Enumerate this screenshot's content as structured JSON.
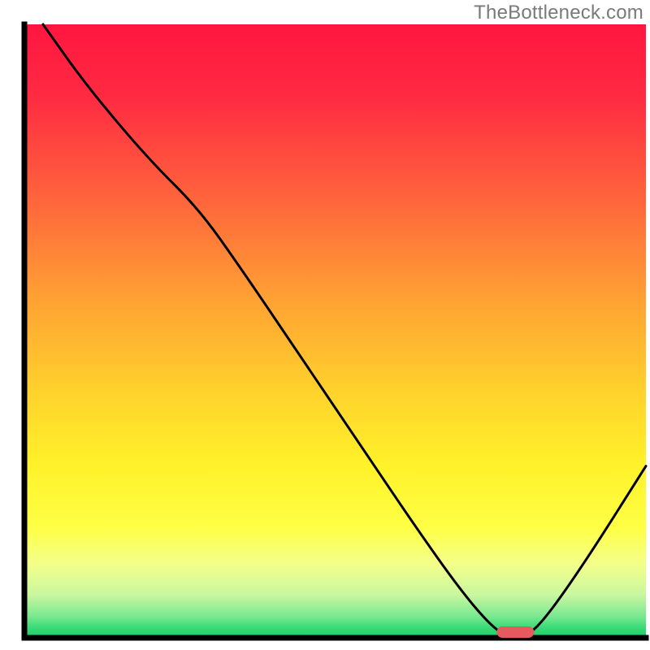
{
  "watermark": "TheBottleneck.com",
  "chart_data": {
    "type": "line",
    "title": "",
    "xlabel": "",
    "ylabel": "",
    "xlim": [
      0,
      100
    ],
    "ylim": [
      0,
      100
    ],
    "grid": false,
    "series": [
      {
        "name": "bottleneck-curve",
        "x": [
          3,
          10,
          20,
          28,
          35,
          45,
          55,
          63,
          70,
          75,
          78,
          80,
          83,
          90,
          100
        ],
        "y": [
          100,
          90,
          78,
          70,
          60,
          45,
          30,
          18,
          8,
          2,
          0,
          0,
          2,
          12,
          28
        ]
      }
    ],
    "marker": {
      "name": "optimal-range",
      "x_center": 79,
      "y": 0,
      "width": 6
    },
    "background_gradient": {
      "stops": [
        {
          "offset": 0.0,
          "color": "#ff163f"
        },
        {
          "offset": 0.12,
          "color": "#ff2b42"
        },
        {
          "offset": 0.3,
          "color": "#ff6a3b"
        },
        {
          "offset": 0.45,
          "color": "#ffa233"
        },
        {
          "offset": 0.6,
          "color": "#ffd22c"
        },
        {
          "offset": 0.72,
          "color": "#fff22a"
        },
        {
          "offset": 0.82,
          "color": "#feff45"
        },
        {
          "offset": 0.88,
          "color": "#f4ff8a"
        },
        {
          "offset": 0.93,
          "color": "#c9f7a0"
        },
        {
          "offset": 0.965,
          "color": "#7ae890"
        },
        {
          "offset": 0.985,
          "color": "#34d975"
        },
        {
          "offset": 1.0,
          "color": "#1fce6a"
        }
      ]
    }
  }
}
